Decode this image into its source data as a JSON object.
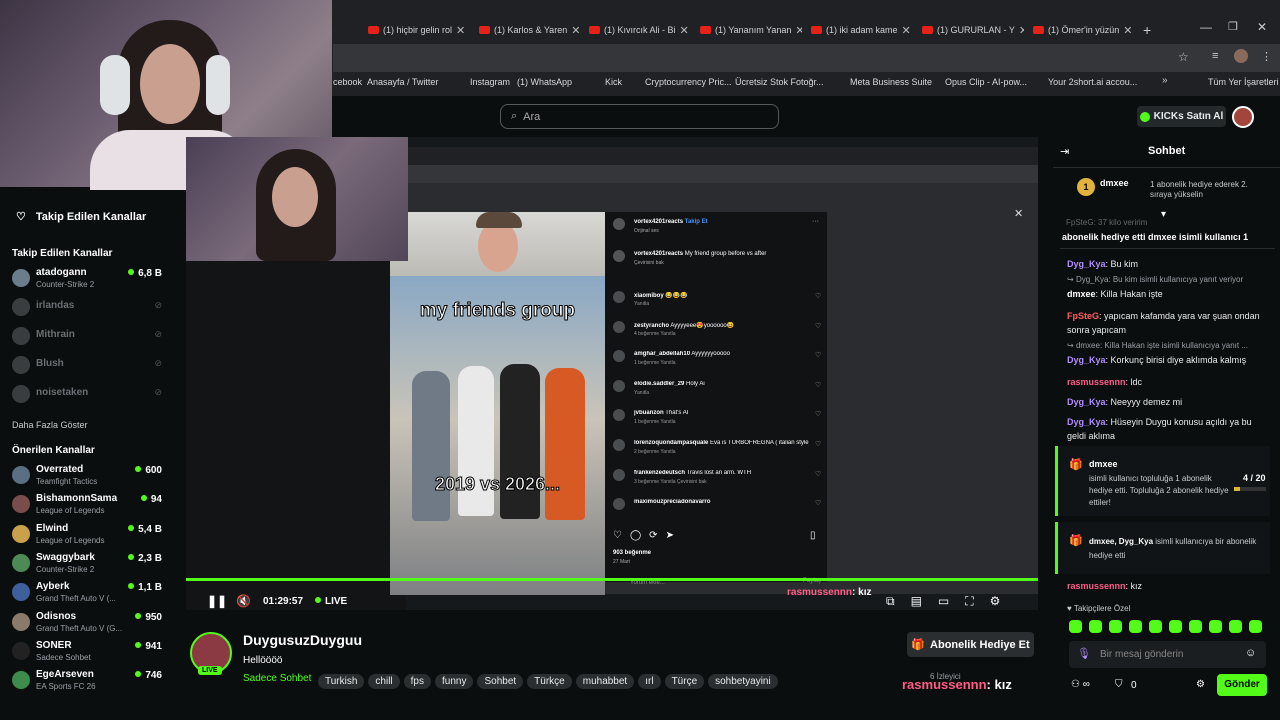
{
  "browser": {
    "tabs": [
      "(1) hiçbir gelin rol",
      "(1) Karlos & Yaren",
      "(1) Kıvırcık Ali - Bi",
      "(1) Yananım Yanan",
      "(1) iki adam kame",
      "(1) GURURLAN - Y",
      "(1) Ömer'in yüzün"
    ],
    "bookmarks": [
      "cebook",
      "Anasayfa / Twitter",
      "Instagram",
      "(1) WhatsApp",
      "Kick",
      "Cryptocurrency Pric...",
      "Ücretsiz Stok Fotoğr...",
      "Meta Business Suite",
      "Opus Clip - AI-pow...",
      "Your 2short.ai accou...",
      "Tüm Yer İşaretleri"
    ]
  },
  "header": {
    "search_placeholder": "Ara",
    "kicks_button": "KICKs Satın Al"
  },
  "sidebar": {
    "followed_label": "Takip Edilen Kanallar",
    "following_section_title": "Takip Edilen Kanallar",
    "following": [
      {
        "name": "atadogann",
        "game": "Counter-Strike 2",
        "viewers": "6,8 B",
        "live": true
      },
      {
        "name": "irlandas",
        "game": "",
        "viewers": "",
        "live": false
      },
      {
        "name": "Mithrain",
        "game": "",
        "viewers": "",
        "live": false
      },
      {
        "name": "Blush",
        "game": "",
        "viewers": "",
        "live": false
      },
      {
        "name": "noisetaken",
        "game": "",
        "viewers": "",
        "live": false
      }
    ],
    "show_more": "Daha Fazla Göster",
    "recommended_title": "Önerilen Kanallar",
    "recommended": [
      {
        "name": "Overrated",
        "game": "Teamfight Tactics",
        "viewers": "600"
      },
      {
        "name": "BishamonnSama",
        "game": "League of Legends",
        "viewers": "94"
      },
      {
        "name": "Elwind",
        "game": "League of Legends",
        "viewers": "5,4 B"
      },
      {
        "name": "Swaggybark",
        "game": "Counter-Strike 2",
        "viewers": "2,3 B"
      },
      {
        "name": "Ayberk",
        "game": "Grand Theft Auto V (...",
        "viewers": "1,1 B"
      },
      {
        "name": "Odisnos",
        "game": "Grand Theft Auto V (G...",
        "viewers": "950"
      },
      {
        "name": "SONER",
        "game": "Sadece Sohbet",
        "viewers": "941"
      },
      {
        "name": "EgeArseven",
        "game": "EA Sports FC 26",
        "viewers": "746"
      }
    ]
  },
  "player": {
    "time": "01:29:57",
    "live_label": "LIVE",
    "overlay_user": "rasmussennn",
    "overlay_msg": ": kız",
    "video_caption_top": "my friends group",
    "video_caption_bottom": "2019 vs 2026..."
  },
  "instagram": {
    "poster": "vortex4201reacts",
    "follow": "Takip Et",
    "audio": "Orijinal ses",
    "caption": "My friend group before vs after",
    "translate": "Çevirisini bak",
    "comments": [
      {
        "user": "xiaomiboy",
        "text": "😂😂😂",
        "meta": "Yanıtla"
      },
      {
        "user": "zestyrancho",
        "text": "Ayyyyeee😍yoooooo😆",
        "meta": "4 beğenme  Yanıtla"
      },
      {
        "user": "amghar_abdellah10",
        "text": "Ayyyyyyooooo",
        "meta": "1 beğenme  Yanıtla"
      },
      {
        "user": "elodie.saddler_29",
        "text": "Holy Ai",
        "meta": "Yanıtla"
      },
      {
        "user": "jvbuanzon",
        "text": "That's AI",
        "meta": "1 beğenme  Yanıtla"
      },
      {
        "user": "lorenzoquondampasquale",
        "text": "Eva is TURBOFREGNA ( italian style)",
        "meta": "2 beğenme  Yanıtla"
      },
      {
        "user": "frankenzedeutsch",
        "text": "Travis lost an arm. WTH",
        "meta": "3 beğenme  Yanıtla  Çevirisini bak"
      },
      {
        "user": "maximouzpreciadonavarro",
        "text": "",
        "meta": ""
      }
    ],
    "likes": "903 beğenme",
    "date": "27 Mart",
    "comment_placeholder": "Yorum ekle...",
    "share": "Paylaş"
  },
  "streamer": {
    "name": "DuygusuzDuyguu",
    "title": "Hellöööö",
    "category": "Sadece Sohbet",
    "tags": [
      "Turkish",
      "chill",
      "fps",
      "funny",
      "Sohbet",
      "Türkçe",
      "muhabbet",
      "ırl",
      "Türçe",
      "sohbetyayini"
    ],
    "live_badge": "LIVE",
    "gift_sub_button": "Abonelik Hediye Et",
    "viewers": "6 İzleyici",
    "overlay_user": "rasmussennn",
    "overlay_msg": ": kız"
  },
  "chat": {
    "title": "Sohbet",
    "pinned": {
      "user": "dmxee",
      "rank": "1",
      "text": "1 abonelik hediye ederek 2. sıraya yükselin"
    },
    "ticker": "abonelik hediye etti  dmxee isimli kullanıcı 1",
    "faded_top": "FpSteG: 37 kilo veririm",
    "messages": [
      {
        "user": "Dyg_Kya",
        "color": "#b18cff",
        "text": "Bu kim"
      },
      {
        "reply": "Dyg_Kya: Bu kim isimli kullanıcıya yanıt veriyor",
        "user": "dmxee",
        "color": "#ffffff",
        "text": "Killa Hakan işte"
      },
      {
        "user": "FpSteG",
        "color": "#ff5c5c",
        "text": "yapıcam kafamda yara var şuan ondan sonra yapıcam"
      },
      {
        "reply": "dmxee: Killa Hakan işte isimli kullanıcıya yanıt ...",
        "user": "Dyg_Kya",
        "color": "#b18cff",
        "text": "Korkunç birisi diye aklımda kalmış"
      },
      {
        "user": "rasmussennn",
        "color": "#ff5c86",
        "text": "ldc"
      },
      {
        "user": "Dyg_Kya",
        "color": "#b18cff",
        "text": "Neeyyy demez mi"
      },
      {
        "user": "Dyg_Kya",
        "color": "#b18cff",
        "text": "Hüseyin Duygu konusu açıldı ya bu geldi aklıma"
      }
    ],
    "gift1": {
      "user": "dmxee",
      "text": "isimli kullanıcı topluluğa 1 abonelik hediye etti. Topluluğa 2 abonelik hediye ettiler!",
      "progress": "4 / 20",
      "fraction": 0.2
    },
    "gift2": {
      "users": "dmxee, Dyg_Kya",
      "text": "isimli kullanıcıya bir abonelik hediye etti"
    },
    "last": {
      "user": "rasmussennn",
      "color": "#ff5c86",
      "text": "kız"
    },
    "emote_label": "Takipçilere Özel",
    "input_placeholder": "Bir mesaj gönderin",
    "send_button": "Gönder",
    "points": "0"
  }
}
